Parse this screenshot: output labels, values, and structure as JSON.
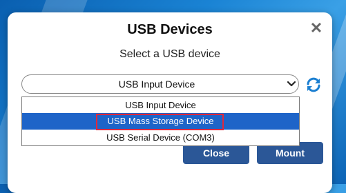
{
  "dialog": {
    "title": "USB Devices",
    "subtitle": "Select a USB device"
  },
  "select": {
    "value": "USB Input Device"
  },
  "dropdown": {
    "options": [
      "USB Input Device",
      "USB Mass Storage Device",
      "USB Serial Device (COM3)"
    ],
    "highlighted_index": 1
  },
  "buttons": {
    "close_label": "Close",
    "mount_label": "Mount"
  },
  "colors": {
    "accent": "#2b5797",
    "selection": "#1e64c8",
    "highlight_border": "#e0283c",
    "refresh_icon": "#1b7fd1"
  },
  "icons": {
    "close": "close-icon",
    "chevron": "chevron-down-icon",
    "refresh": "refresh-icon"
  }
}
